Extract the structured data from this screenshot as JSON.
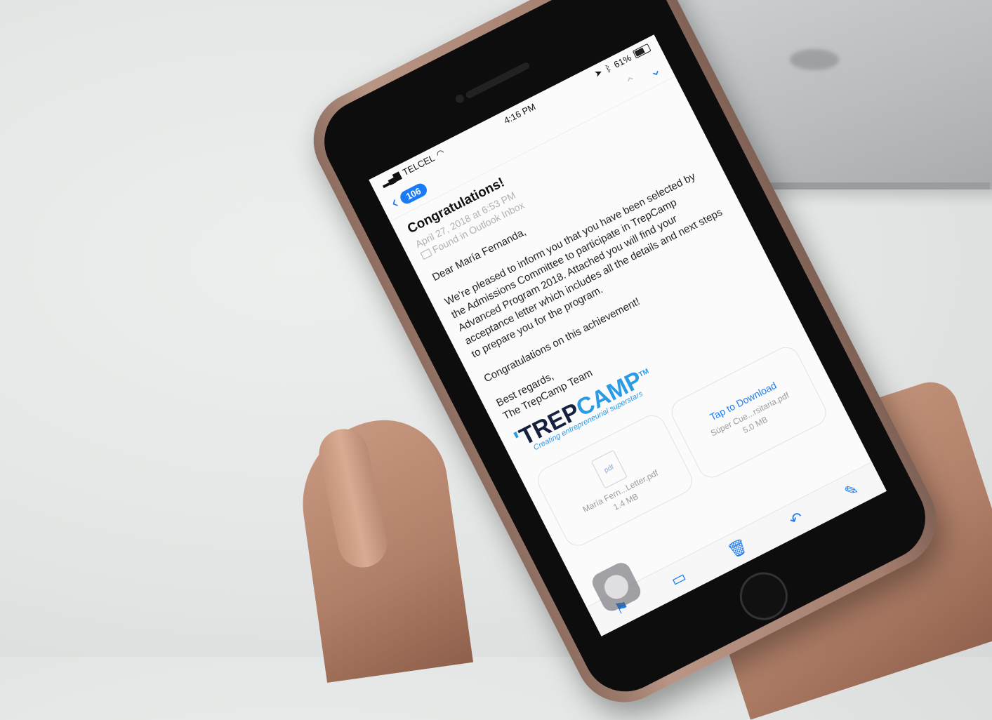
{
  "status_bar": {
    "carrier": "TELCEL",
    "time": "4:16 PM",
    "battery": "61%"
  },
  "nav": {
    "back_count": "106"
  },
  "email": {
    "subject": "Congratulations!",
    "date": "April 27, 2018 at 6:53 PM",
    "folder": "Found in Outlook Inbox",
    "greeting": "Dear María Fernanda,",
    "paragraph": "We’re pleased to inform you that you have been selected by the Admissions Committee to participate in TrepCamp Advanced Program 2018. Attached you will find your acceptance letter which includes all the details and next steps to prepare you for the program.",
    "congrats_line": "Congratulations on this achievement!",
    "signoff": "Best regards,",
    "signature": "The TrepCamp Team"
  },
  "logo": {
    "trep": "TREP",
    "camp": "CAMP",
    "tm": "TM",
    "tagline": "Creating entrepreneurial superstars"
  },
  "attachments": [
    {
      "icon_label": "pdf",
      "name": "María Fern...Letter.pdf",
      "size": "1.4 MB"
    },
    {
      "action": "Tap to Download",
      "name": "Súper Cue...rsitaria.pdf",
      "size": "5.0 MB"
    }
  ],
  "icons": {
    "wifi": "wifi-icon",
    "flag": "flag-icon",
    "folder": "folder-icon",
    "trash": "trash-icon",
    "reply": "reply-icon",
    "compose": "compose-icon"
  },
  "colors": {
    "ios_blue": "#1a7cf5",
    "logo_blue": "#2b9be6",
    "logo_navy": "#16213e"
  }
}
